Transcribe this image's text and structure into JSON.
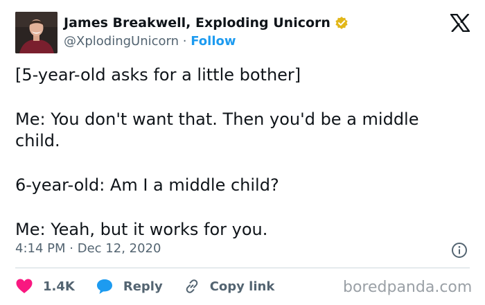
{
  "tweet": {
    "author_name": "James Breakwell, Exploding Unicorn",
    "handle": "@XplodingUnicorn",
    "separator": "·",
    "follow_label": "Follow",
    "lines": [
      "[5-year-old asks for a little bother]",
      "Me: You don't want that. Then you'd be a middle child.",
      "6-year-old: Am I a middle child?",
      "Me: Yeah, but it works for you."
    ],
    "time": "4:14 PM",
    "date": "Dec 12, 2020"
  },
  "actions": {
    "likes": "1.4K",
    "reply_label": "Reply",
    "copy_link_label": "Copy link"
  },
  "watermark": "boredpanda.com",
  "colors": {
    "link_blue": "#1d9bf0",
    "heart_pink": "#f91880",
    "verified_gold": "#e2b719",
    "muted_gray": "#536471"
  },
  "icons": {
    "platform": "x-logo-icon",
    "verified": "verified-badge-icon",
    "info": "info-icon",
    "like": "heart-icon",
    "reply": "reply-bubble-icon",
    "copy": "link-icon"
  }
}
